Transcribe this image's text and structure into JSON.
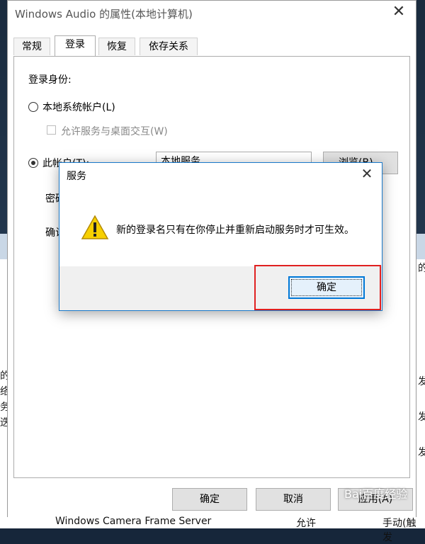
{
  "background": {
    "left_fragments": [
      "的",
      "络",
      "务",
      "迭"
    ],
    "right_fragments": [
      "[",
      "发",
      "发",
      "发"
    ],
    "bottom_row": {
      "name": "Windows Camera Frame Server",
      "status": "允许",
      "start_type": "手动(触发"
    }
  },
  "window": {
    "title": "Windows Audio 的属性(本地计算机)",
    "tabs": [
      "常规",
      "登录",
      "恢复",
      "依存关系"
    ],
    "active_tab": "登录",
    "logon_as_label": "登录身份:",
    "local_system_label": "本地系统帐户(L)",
    "interact_desktop_label": "允许服务与桌面交互(W)",
    "this_account_label": "此帐户(T):",
    "account_value": "本地服务",
    "browse_label": "浏览(B)...",
    "password_label": "密码",
    "confirm_label": "确认",
    "buttons": {
      "ok": "确定",
      "cancel": "取消",
      "apply": "应用(A)"
    }
  },
  "dialog": {
    "title": "服务",
    "message": "新的登录名只有在你停止并重新启动服务时才可生效。",
    "ok_label": "确定"
  },
  "watermark": "Bai百度经验",
  "colors": {
    "accent": "#0078d7",
    "highlight": "#e02020",
    "warning": "#f7d000"
  }
}
